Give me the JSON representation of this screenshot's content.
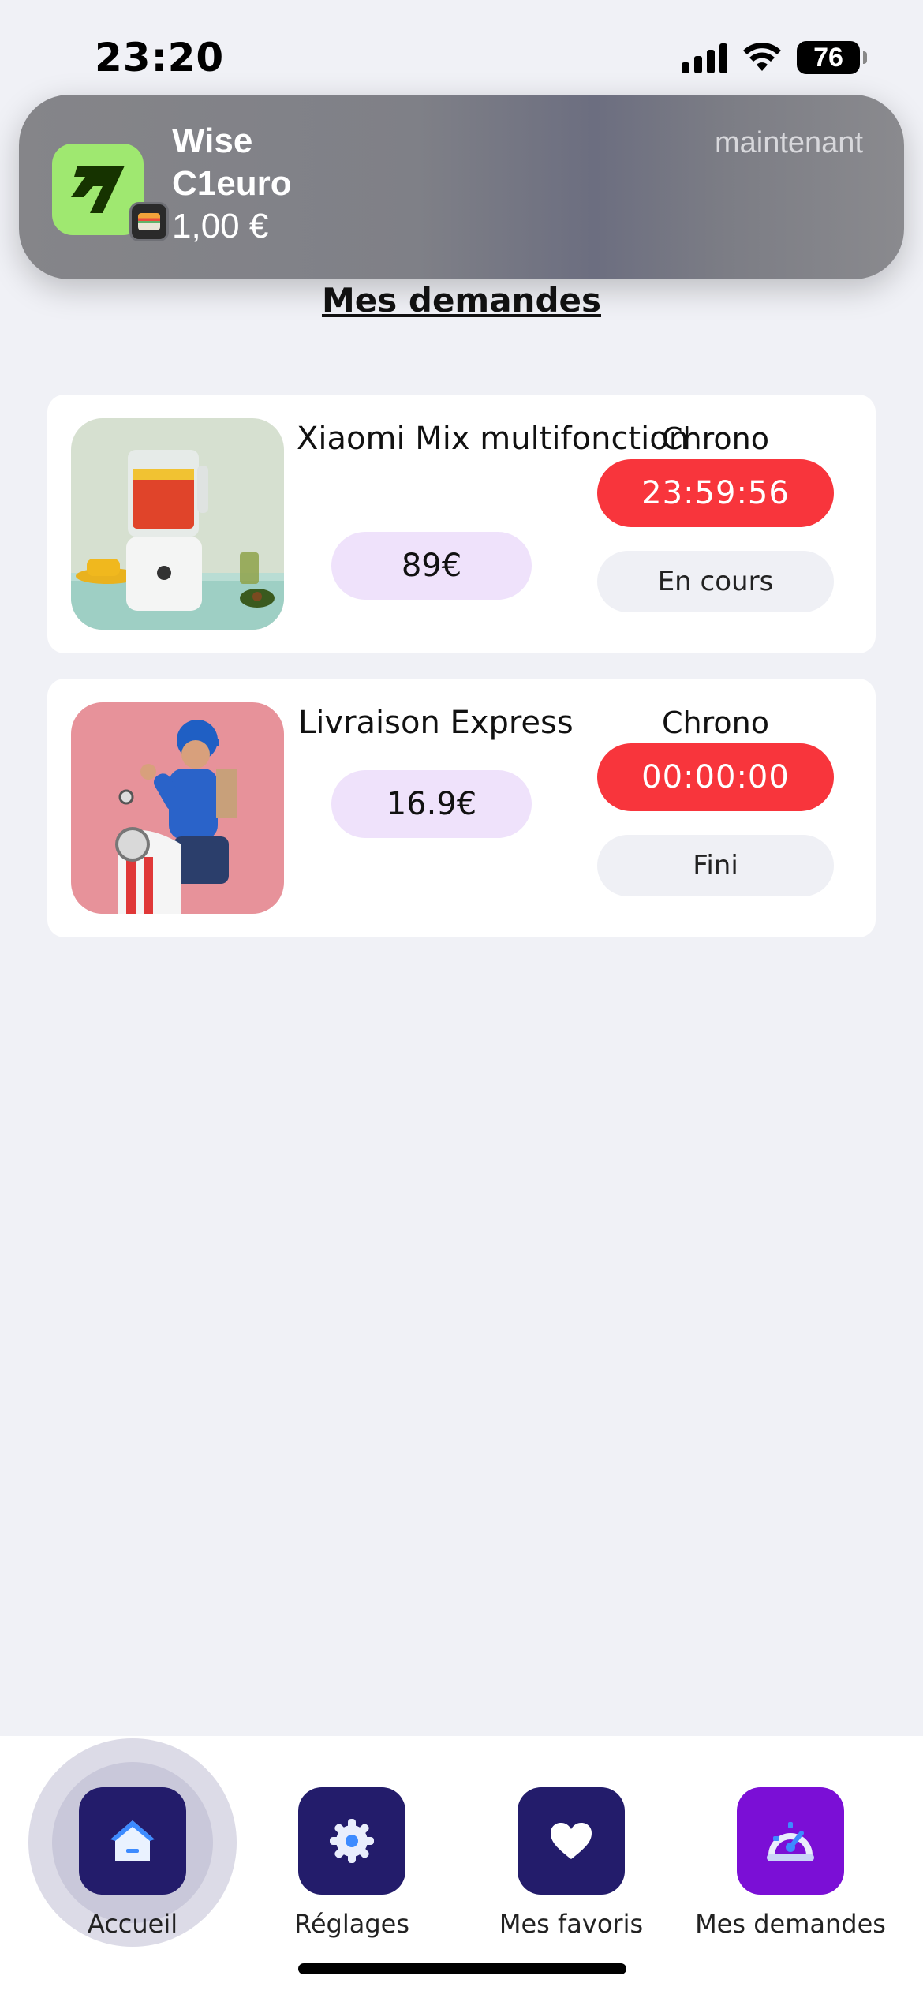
{
  "status_bar": {
    "time": "23:20",
    "battery": "76"
  },
  "notification": {
    "app": "Wise",
    "title": "C1euro",
    "body": "1,00 €",
    "time": "maintenant"
  },
  "page": {
    "title": "Mes demandes"
  },
  "requests": [
    {
      "name": "Xiaomi Mix multifonction",
      "price": "89€",
      "chrono_label": "Chrono",
      "timer": "23:59:56",
      "status": "En cours"
    },
    {
      "name": "Livraison Express",
      "price": "16.9€",
      "chrono_label": "Chrono",
      "timer": "00:00:00",
      "status": "Fini"
    }
  ],
  "nav": {
    "items": [
      {
        "label": "Accueil",
        "icon": "home-icon",
        "active": true
      },
      {
        "label": "Réglages",
        "icon": "gear-icon"
      },
      {
        "label": "Mes favoris",
        "icon": "heart-icon"
      },
      {
        "label": "Mes demandes",
        "icon": "speedometer-icon"
      }
    ]
  },
  "colors": {
    "background": "#f0f1f6",
    "nav_button": "#231c6b",
    "nav_button_active_demandes": "#7b0fd6",
    "timer_red": "#f8353c",
    "price_pill": "#efe2fb",
    "wise_green": "#9fe870"
  }
}
